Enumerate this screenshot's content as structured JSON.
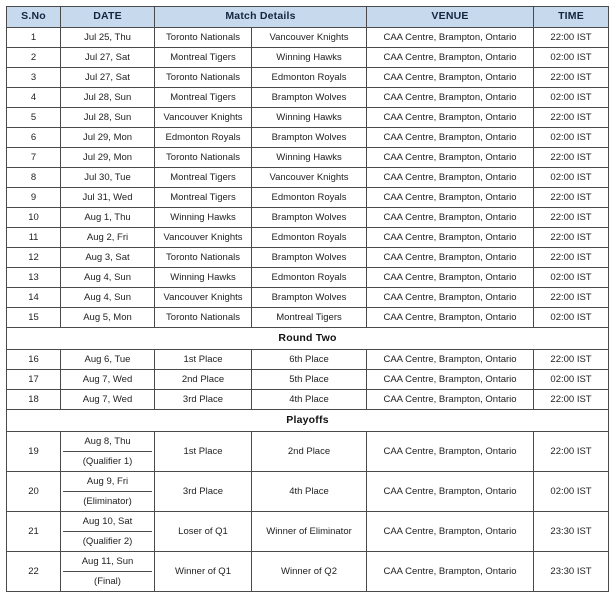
{
  "table": {
    "headers": {
      "sno": "S.No",
      "date": "DATE",
      "match_details": "Match Details",
      "venue": "VENUE",
      "time": "TIME"
    },
    "venue_default": "CAA Centre, Brampton, Ontario",
    "section_round_two": "Round Two",
    "section_playoffs": "Playoffs",
    "header_bg": "#c6d9ed",
    "border_color": "#4a4a4a",
    "rows": [
      {
        "sno": "1",
        "date": "Jul 25, Thu",
        "team1": "Toronto Nationals",
        "team2": "Vancouver Knights",
        "venue": "CAA Centre, Brampton, Ontario",
        "time": "22:00 IST"
      },
      {
        "sno": "2",
        "date": "Jul 27, Sat",
        "team1": "Montreal Tigers",
        "team2": "Winning Hawks",
        "venue": "CAA Centre, Brampton, Ontario",
        "time": "02:00 IST"
      },
      {
        "sno": "3",
        "date": "Jul 27, Sat",
        "team1": "Toronto Nationals",
        "team2": "Edmonton Royals",
        "venue": "CAA Centre, Brampton, Ontario",
        "time": "22:00 IST"
      },
      {
        "sno": "4",
        "date": "Jul 28, Sun",
        "team1": "Montreal Tigers",
        "team2": "Brampton Wolves",
        "venue": "CAA Centre, Brampton, Ontario",
        "time": "02:00 IST"
      },
      {
        "sno": "5",
        "date": "Jul 28, Sun",
        "team1": "Vancouver Knights",
        "team2": "Winning Hawks",
        "venue": "CAA Centre, Brampton, Ontario",
        "time": "22:00 IST"
      },
      {
        "sno": "6",
        "date": "Jul 29, Mon",
        "team1": "Edmonton Royals",
        "team2": "Brampton Wolves",
        "venue": "CAA Centre, Brampton, Ontario",
        "time": "02:00 IST"
      },
      {
        "sno": "7",
        "date": "Jul 29, Mon",
        "team1": "Toronto Nationals",
        "team2": "Winning Hawks",
        "venue": "CAA Centre, Brampton, Ontario",
        "time": "22:00 IST"
      },
      {
        "sno": "8",
        "date": "Jul 30, Tue",
        "team1": "Montreal Tigers",
        "team2": "Vancouver Knights",
        "venue": "CAA Centre, Brampton, Ontario",
        "time": "02:00 IST"
      },
      {
        "sno": "9",
        "date": "Jul 31, Wed",
        "team1": "Montreal Tigers",
        "team2": "Edmonton Royals",
        "venue": "CAA Centre, Brampton, Ontario",
        "time": "22:00 IST"
      },
      {
        "sno": "10",
        "date": "Aug 1, Thu",
        "team1": "Winning Hawks",
        "team2": "Brampton Wolves",
        "venue": "CAA Centre, Brampton, Ontario",
        "time": "22:00 IST"
      },
      {
        "sno": "11",
        "date": "Aug 2, Fri",
        "team1": "Vancouver Knights",
        "team2": "Edmonton Royals",
        "venue": "CAA Centre, Brampton, Ontario",
        "time": "22:00 IST"
      },
      {
        "sno": "12",
        "date": "Aug 3, Sat",
        "team1": "Toronto Nationals",
        "team2": "Brampton Wolves",
        "venue": "CAA Centre, Brampton, Ontario",
        "time": "22:00 IST"
      },
      {
        "sno": "13",
        "date": "Aug 4, Sun",
        "team1": "Winning Hawks",
        "team2": "Edmonton Royals",
        "venue": "CAA Centre, Brampton, Ontario",
        "time": "02:00 IST"
      },
      {
        "sno": "14",
        "date": "Aug 4, Sun",
        "team1": "Vancouver Knights",
        "team2": "Brampton Wolves",
        "venue": "CAA Centre, Brampton, Ontario",
        "time": "22:00 IST"
      },
      {
        "sno": "15",
        "date": "Aug 5, Mon",
        "team1": "Toronto Nationals",
        "team2": "Montreal Tigers",
        "venue": "CAA Centre, Brampton, Ontario",
        "time": "02:00 IST"
      }
    ],
    "round_two_rows": [
      {
        "sno": "16",
        "date": "Aug 6, Tue",
        "team1": "1st Place",
        "team2": "6th Place",
        "venue": "CAA Centre, Brampton, Ontario",
        "time": "22:00 IST"
      },
      {
        "sno": "17",
        "date": "Aug 7, Wed",
        "team1": "2nd Place",
        "team2": "5th Place",
        "venue": "CAA Centre, Brampton, Ontario",
        "time": "02:00 IST"
      },
      {
        "sno": "18",
        "date": "Aug 7, Wed",
        "team1": "3rd Place",
        "team2": "4th Place",
        "venue": "CAA Centre, Brampton, Ontario",
        "time": "22:00 IST"
      }
    ],
    "playoff_rows": [
      {
        "sno": "19",
        "date_line1": "Aug 8, Thu",
        "date_line2": "(Qualifier 1)",
        "team1": "1st Place",
        "team2": "2nd Place",
        "venue": "CAA Centre, Brampton, Ontario",
        "time": "22:00 IST"
      },
      {
        "sno": "20",
        "date_line1": "Aug 9, Fri",
        "date_line2": "(Eliminator)",
        "team1": "3rd Place",
        "team2": "4th Place",
        "venue": "CAA Centre, Brampton, Ontario",
        "time": "02:00 IST"
      },
      {
        "sno": "21",
        "date_line1": "Aug 10, Sat",
        "date_line2": "(Qualifier 2)",
        "team1": "Loser of Q1",
        "team2": "Winner of Eliminator",
        "venue": "CAA Centre, Brampton, Ontario",
        "time": "23:30 IST"
      },
      {
        "sno": "22",
        "date_line1": "Aug 11, Sun",
        "date_line2": "(Final)",
        "team1": "Winner of Q1",
        "team2": "Winner of Q2",
        "venue": "CAA Centre, Brampton, Ontario",
        "time": "23:30 IST"
      }
    ]
  }
}
